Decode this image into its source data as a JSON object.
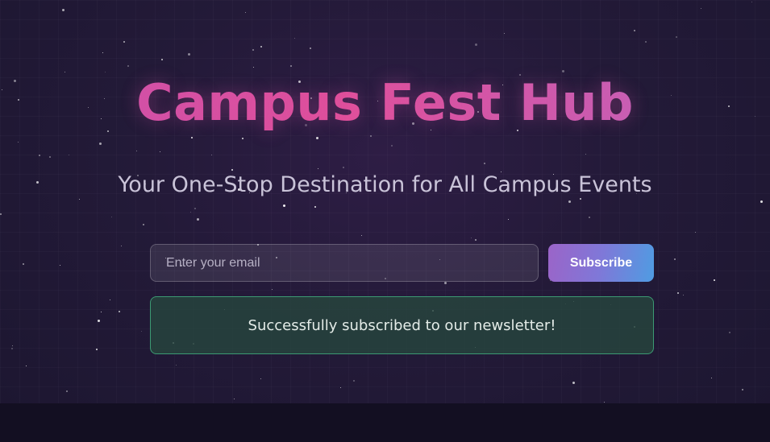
{
  "hero": {
    "title": "Campus Fest Hub",
    "subtitle": "Your One-Stop Destination for All Campus Events"
  },
  "newsletter": {
    "email_placeholder": "Enter your email",
    "email_value": "",
    "subscribe_label": "Subscribe",
    "success_message": "Successfully subscribed to our newsletter!"
  },
  "colors": {
    "background": "#231a38",
    "title_gradient_start": "#c852ad",
    "title_gradient_mid": "#e0509a",
    "title_gradient_end": "#b969c2",
    "button_gradient_start": "#9b64c8",
    "button_gradient_end": "#4f9ce2",
    "success_border": "#3c9a73"
  }
}
